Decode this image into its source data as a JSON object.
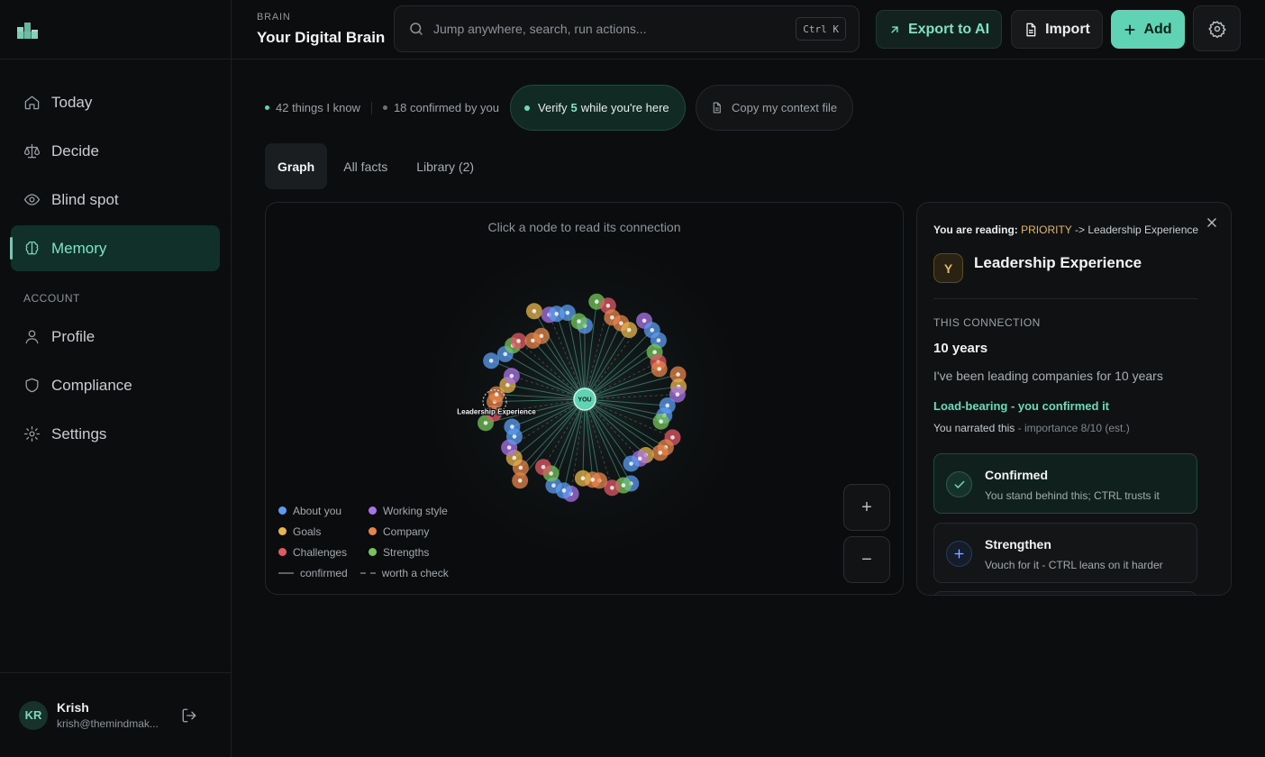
{
  "sidebar": {
    "items": [
      {
        "label": "Today",
        "icon": "home-icon"
      },
      {
        "label": "Decide",
        "icon": "scale-icon"
      },
      {
        "label": "Blind spot",
        "icon": "eye-icon"
      },
      {
        "label": "Memory",
        "icon": "brain-icon",
        "active": true
      }
    ],
    "account_label": "ACCOUNT",
    "account_items": [
      {
        "label": "Profile",
        "icon": "user-icon"
      },
      {
        "label": "Compliance",
        "icon": "shield-icon"
      },
      {
        "label": "Settings",
        "icon": "gear-icon"
      }
    ],
    "user": {
      "initials": "KR",
      "name": "Krish",
      "email": "krish@themindmak..."
    }
  },
  "header": {
    "section": "BRAIN",
    "title": "Your Digital Brain",
    "search_placeholder": "Jump anywhere, search, run actions...",
    "shortcut": "Ctrl K",
    "export_label": "Export to AI",
    "import_label": "Import",
    "add_label": "Add"
  },
  "stats": {
    "known": "42 things I know",
    "confirmed": "18 confirmed by you",
    "verify_prefix": "Verify",
    "verify_count": "5",
    "verify_suffix": "while you're here",
    "copy_label": "Copy my context file"
  },
  "tabs": [
    "Graph",
    "All facts",
    "Library (2)"
  ],
  "graph": {
    "hint": "Click a node to read its connection",
    "center_label": "YOU",
    "selected_label": "Leadership Experience",
    "legend": [
      {
        "label": "About you",
        "color": "#5b9cf0"
      },
      {
        "label": "Working style",
        "color": "#a874e6"
      },
      {
        "label": "Goals",
        "color": "#e6b54e"
      },
      {
        "label": "Company",
        "color": "#e5854a"
      },
      {
        "label": "Challenges",
        "color": "#e05a66"
      },
      {
        "label": "Strengths",
        "color": "#76c45c"
      }
    ],
    "line_confirmed": "confirmed",
    "line_check": "worth a check",
    "zoom_in": "+",
    "zoom_out": "−"
  },
  "detail": {
    "reading_prefix": "You are reading:",
    "reading_source": "PRIORITY",
    "reading_arrow": "->",
    "reading_target": "Leadership Experience",
    "badge": "Y",
    "title": "Leadership Experience",
    "section_label": "THIS CONNECTION",
    "value": "10 years",
    "description": "I've been leading companies for 10 years",
    "status": "Load-bearing - you confirmed it",
    "narrated": "You narrated this",
    "importance": "- importance 8/10 (est.)",
    "options": [
      {
        "title": "Confirmed",
        "subtitle": "You stand behind this; CTRL trusts it"
      },
      {
        "title": "Strengthen",
        "subtitle": "Vouch for it - CTRL leans on it harder"
      }
    ]
  },
  "colors": {
    "accent": "#5fd3b3",
    "warning": "#e0b770",
    "background": "#0c0d0f"
  }
}
